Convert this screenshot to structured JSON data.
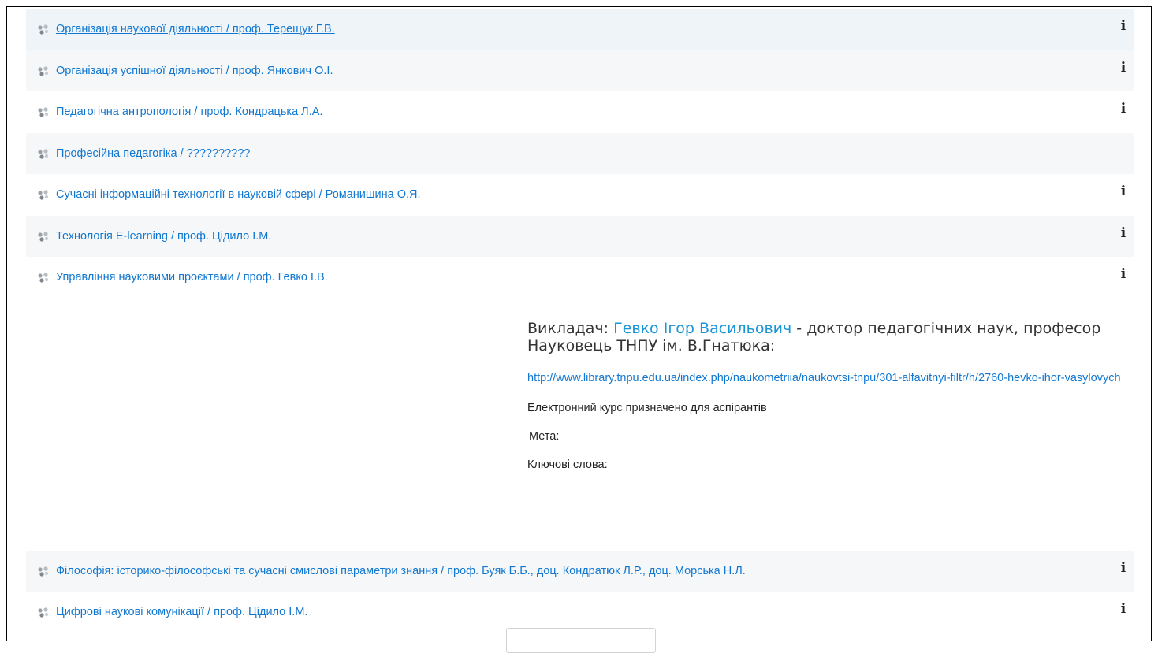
{
  "courses": [
    {
      "label": "Організація наукової діяльності / проф. Терещук Г.В.",
      "has_info": true
    },
    {
      "label": "Організація успішної діяльності / проф. Янкович О.І.",
      "has_info": true
    },
    {
      "label": "Педагогічна антропологія / проф. Кондрацька Л.А.",
      "has_info": true
    },
    {
      "label": "Професійна педагогіка / ??????????",
      "has_info": false
    },
    {
      "label": "Сучасні інформаційні технології в науковій сфері / Романишина О.Я.",
      "has_info": true
    },
    {
      "label": "Технологія E-learning / проф. Цідило І.М.",
      "has_info": true
    },
    {
      "label": "Управління науковими проєктами / проф. Гевко І.В.",
      "has_info": true
    },
    {
      "label": "Філософія: історико-філософські та сучасні смислові параметри знання / проф. Буяк Б.Б., доц. Кондратюк Л.Р., доц. Морська Н.Л.",
      "has_info": true
    },
    {
      "label": "Цифрові наукові комунікації / проф. Цідило І.М.",
      "has_info": true
    }
  ],
  "info_glyph": "i",
  "summary": {
    "teacher_prefix": "Викладач:",
    "teacher_name": "Гевко Ігор Васильович",
    "teacher_suffix": " -  доктор педагогічних наук, професор",
    "scientist_line": "Науковець ТНПУ ім. В.Гнатюка:",
    "profile_url": "http://www.library.tnpu.edu.ua/index.php/naukometriia/naukovtsi-tnpu/301-alfavitnyi-filtr/h/2760-hevko-ihor-vasylovych",
    "course_note": "Електронний курс призначено для аспірантів",
    "goal_label": "Мета:",
    "keywords_label": "Ключові слова:"
  },
  "icons": {
    "course": "course-category-icon",
    "info": "info-icon"
  },
  "colors": {
    "link": "#1177d1",
    "teacher_name": "#1a95d6",
    "row_alt": "#f5f7f9",
    "row_first": "#eef4f8"
  }
}
